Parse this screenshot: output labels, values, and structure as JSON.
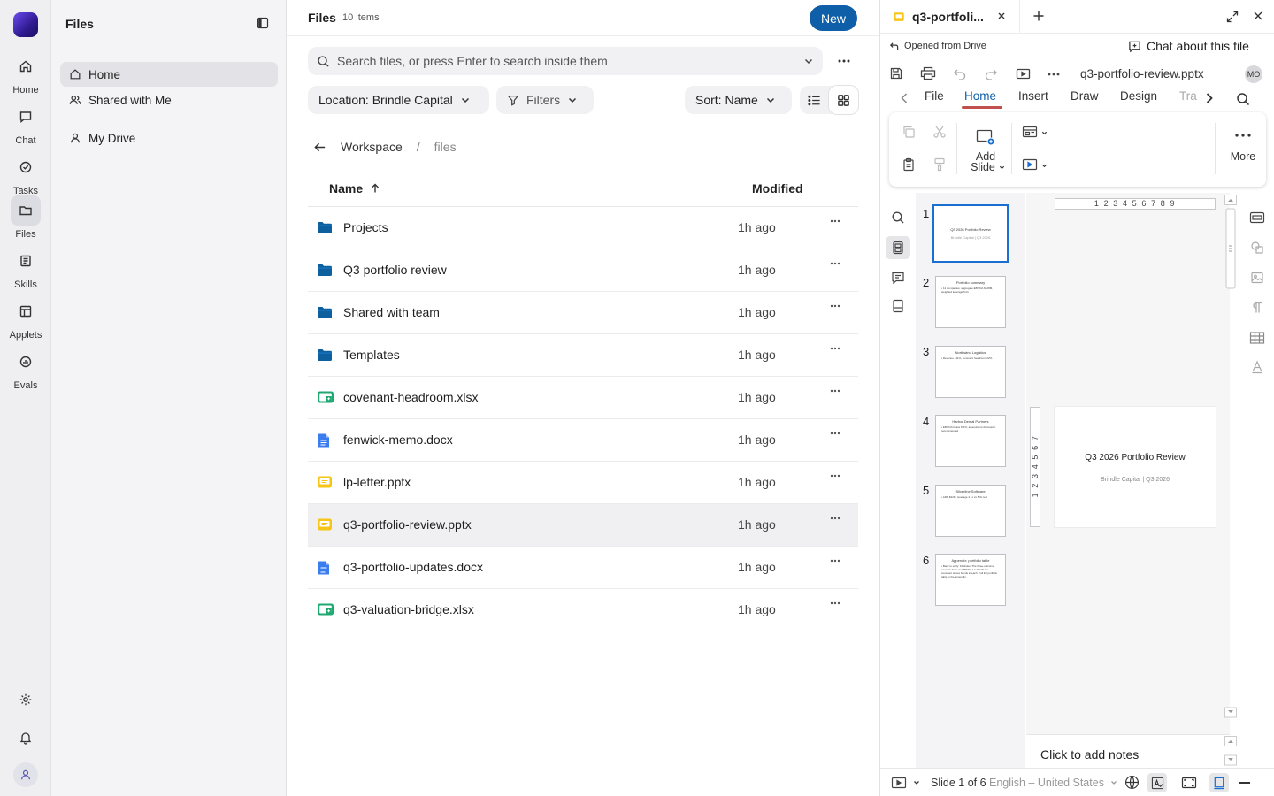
{
  "rail": {
    "items": [
      {
        "label": "Home",
        "icon": "home-icon"
      },
      {
        "label": "Chat",
        "icon": "chat-icon"
      },
      {
        "label": "Tasks",
        "icon": "tasks-icon"
      },
      {
        "label": "Files",
        "icon": "folder-icon"
      },
      {
        "label": "Skills",
        "icon": "skills-icon"
      },
      {
        "label": "Applets",
        "icon": "applets-icon"
      },
      {
        "label": "Evals",
        "icon": "evals-icon"
      }
    ],
    "active": "Files"
  },
  "sidebar": {
    "title": "Files",
    "items": [
      {
        "label": "Home",
        "icon": "home-icon"
      },
      {
        "label": "Shared with Me",
        "icon": "users-icon"
      },
      {
        "label": "My Drive",
        "icon": "user-icon"
      }
    ]
  },
  "files": {
    "title": "Files",
    "count": "10 items",
    "new_label": "New",
    "search_placeholder": "Search files, or press Enter to search inside them",
    "location_label": "Location: Brindle Capital",
    "filters_label": "Filters",
    "sort_label": "Sort: Name",
    "breadcrumb": {
      "root": "Workspace",
      "sep": "/",
      "current": "files"
    },
    "columns": {
      "name": "Name",
      "modified": "Modified"
    },
    "rows": [
      {
        "name": "Projects",
        "type": "folder",
        "modified": "1h ago"
      },
      {
        "name": "Q3 portfolio review",
        "type": "folder",
        "modified": "1h ago"
      },
      {
        "name": "Shared with team",
        "type": "folder",
        "modified": "1h ago"
      },
      {
        "name": "Templates",
        "type": "folder",
        "modified": "1h ago"
      },
      {
        "name": "covenant-headroom.xlsx",
        "type": "xlsx",
        "modified": "1h ago"
      },
      {
        "name": "fenwick-memo.docx",
        "type": "docx",
        "modified": "1h ago"
      },
      {
        "name": "lp-letter.pptx",
        "type": "pptx",
        "modified": "1h ago"
      },
      {
        "name": "q3-portfolio-review.pptx",
        "type": "pptx",
        "modified": "1h ago",
        "selected": true
      },
      {
        "name": "q3-portfolio-updates.docx",
        "type": "docx",
        "modified": "1h ago"
      },
      {
        "name": "q3-valuation-bridge.xlsx",
        "type": "xlsx",
        "modified": "1h ago"
      }
    ]
  },
  "doc": {
    "tab_title": "q3-portfoli...",
    "opened_from": "Opened from Drive",
    "chat_about": "Chat about this file",
    "file_name": "q3-portfolio-review.pptx",
    "user_initials": "MO",
    "ribbon_tabs": [
      "File",
      "Home",
      "Insert",
      "Draw",
      "Design",
      "Tra"
    ],
    "active_ribbon_tab": "Home",
    "ribbon": {
      "add_slide_1": "Add",
      "add_slide_2": "Slide",
      "more": "More"
    },
    "ruler_h": "1 2 3 4 5 6 7 8 9",
    "ruler_v": "1 2 3 4 5 6 7",
    "slides": [
      {
        "num": "1",
        "title": "Q3 2026 Portfolio Review",
        "body": "Brindle Capital | Q3 2026"
      },
      {
        "num": "2",
        "title": "Portfolio summary",
        "body": "• 14 companies; aggregate EBITDA $128M, weighted leverage 5.0x"
      },
      {
        "num": "3",
        "title": "Northwind Logistics",
        "body": "• Revenue +11%, covenant headroom 22%"
      },
      {
        "num": "4",
        "title": "Harbor Dental Partners",
        "body": "• EBITDA below 8.2%; amendment discussion recommended"
      },
      {
        "num": "5",
        "title": "Silverline Software",
        "body": "• ARR $42M, leverage 4.1x vs 5.0x test"
      },
      {
        "num": "6",
        "title": "Appendix: portfolio table",
        "body": "• Back to early: 10 slides. The three-outcome scenario from an EBITDA 1 to 5 with the covenant stress bands in each. Full list portfolio table in the appendix."
      }
    ],
    "current_slide": {
      "title": "Q3 2026 Portfolio Review",
      "subtitle": "Brindle Capital | Q3 2026"
    },
    "notes_placeholder": "Click to add notes",
    "status": {
      "slide": "Slide 1 of 6",
      "language": "English – United States"
    },
    "colors": {
      "accent": "#0f5fa8",
      "tab_underline": "#c0504d",
      "selection": "#1a6fd0"
    }
  }
}
